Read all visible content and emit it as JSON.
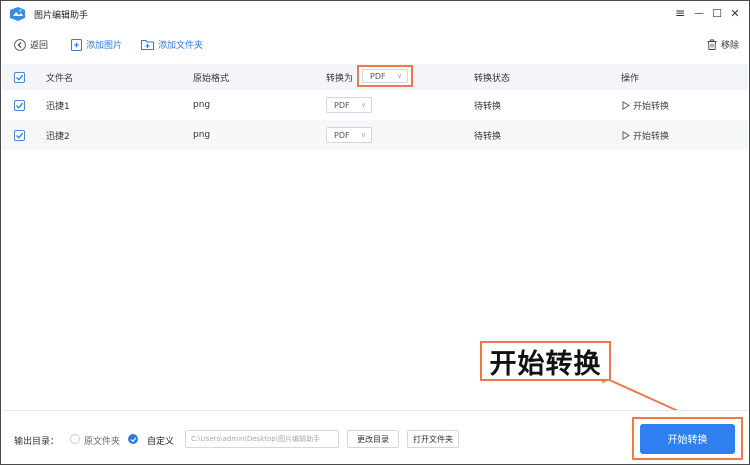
{
  "window": {
    "title": "图片编辑助手",
    "controls": {
      "menu": "≡",
      "minimize": "—",
      "maximize": "☐",
      "close": "✕"
    }
  },
  "toolbar": {
    "back_label": "返回",
    "add_image_label": "添加图片",
    "add_folder_label": "添加文件夹",
    "remove_label": "移除"
  },
  "table": {
    "headers": {
      "filename": "文件名",
      "original_format": "原始格式",
      "convert_to": "转换为",
      "convert_to_value": "PDF",
      "status": "转换状态",
      "action": "操作"
    },
    "rows": [
      {
        "name": "迅捷1",
        "format": "png",
        "target": "PDF",
        "status": "待转换",
        "action": "开始转换"
      },
      {
        "name": "迅捷2",
        "format": "png",
        "target": "PDF",
        "status": "待转换",
        "action": "开始转换"
      }
    ]
  },
  "annotation": {
    "text": "开始转换"
  },
  "bottom": {
    "output_label": "输出目录：",
    "option_original": "原文件夹",
    "option_custom": "自定义",
    "path_value": "C:\\Users\\admin\\Desktop\\图片编辑助手",
    "change_dir_label": "更改目录",
    "open_folder_label": "打开文件夹",
    "start_label": "开始转换"
  },
  "colors": {
    "accent": "#2f7ff0",
    "highlight": "#ee7a4a",
    "header_bg": "#f3f5f8"
  }
}
